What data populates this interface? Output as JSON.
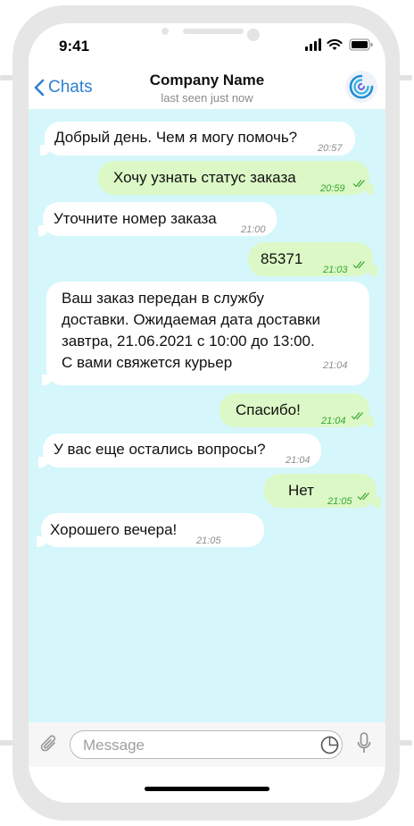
{
  "status_bar": {
    "time": "9:41",
    "icons": [
      "signal-icon",
      "wifi-icon",
      "battery-icon"
    ]
  },
  "nav": {
    "back_label": "Chats",
    "title": "Company Name",
    "subtitle": "last seen just now",
    "avatar_icon": "company-logo-icon"
  },
  "messages": [
    {
      "direction": "in",
      "text": "Добрый день. Чем я могу помочь?",
      "time": "20:57"
    },
    {
      "direction": "out",
      "text": "Хочу узнать статус заказа",
      "time": "20:59"
    },
    {
      "direction": "in",
      "text": "Уточните номер заказа",
      "time": "21:00"
    },
    {
      "direction": "out",
      "text": "85371",
      "time": "21:03"
    },
    {
      "direction": "in",
      "text": "Ваш заказ передан в службу\nдоставки. Ожидаемая дата доставки\nзавтра, 21.06.2021 с 10:00 до 13:00.\nС вами свяжется курьер",
      "time": "21:04"
    },
    {
      "direction": "out",
      "text": "Спасибо!",
      "time": "21:04"
    },
    {
      "direction": "in",
      "text": "У вас еще остались вопросы?",
      "time": "21:04"
    },
    {
      "direction": "out",
      "text": "Нет",
      "time": "21:05"
    },
    {
      "direction": "in",
      "text": "Хорошего вечера!",
      "time": "21:05"
    }
  ],
  "input": {
    "placeholder": "Message",
    "icons": [
      "paperclip-icon",
      "sticker-icon",
      "microphone-icon"
    ]
  },
  "colors": {
    "chat_background": "#d5f7fb",
    "incoming_bubble": "#ffffff",
    "outgoing_bubble": "#dcf8c6",
    "accent": "#2f7fd6",
    "read_check": "#36a634"
  }
}
